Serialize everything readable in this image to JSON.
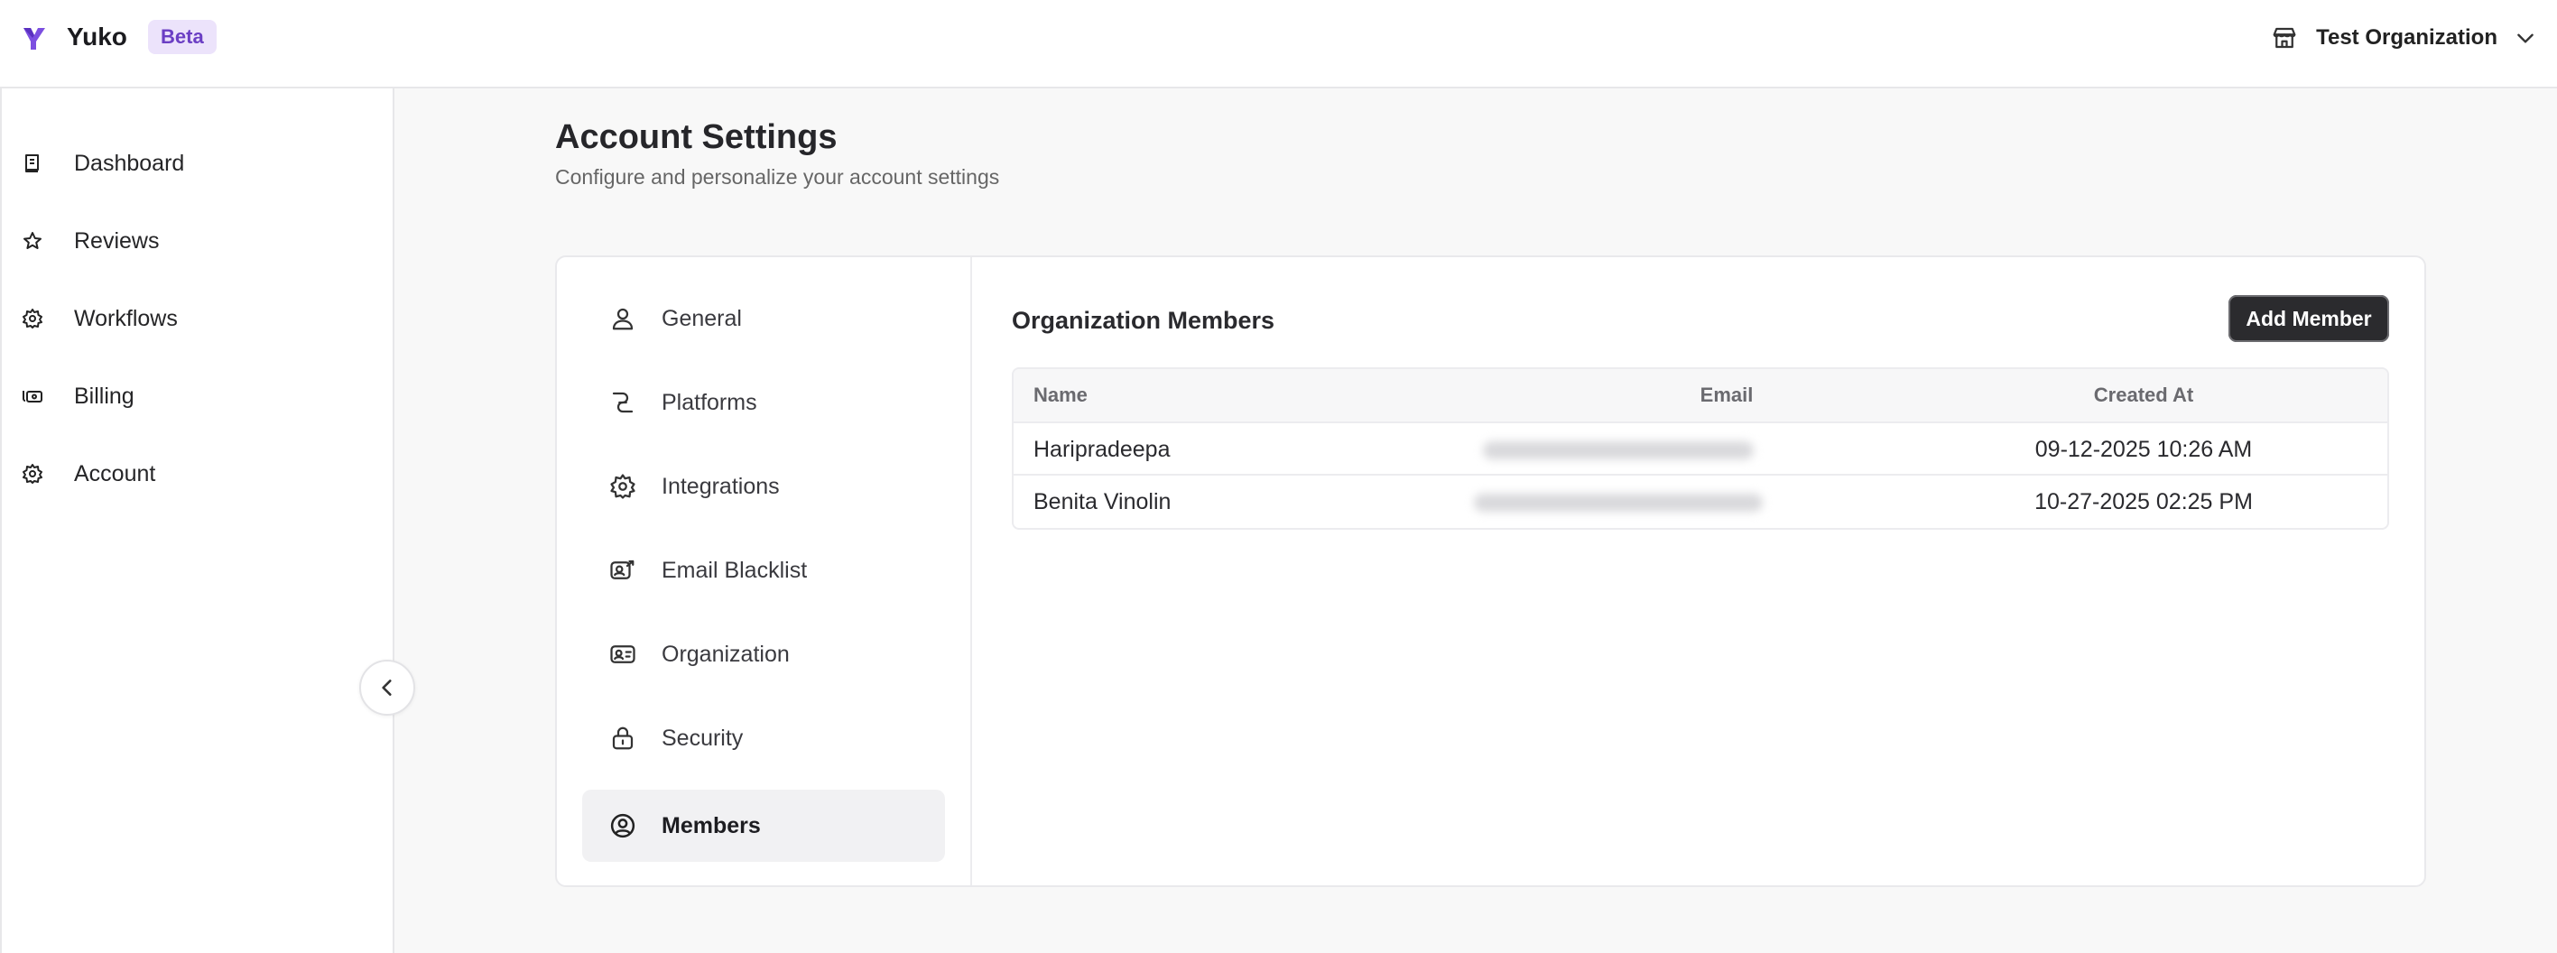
{
  "header": {
    "brand": "Yuko",
    "badge": "Beta",
    "organization": "Test Organization"
  },
  "sidebar": {
    "items": [
      {
        "label": "Dashboard",
        "icon": "book-icon"
      },
      {
        "label": "Reviews",
        "icon": "star-icon"
      },
      {
        "label": "Workflows",
        "icon": "cog-icon"
      },
      {
        "label": "Billing",
        "icon": "cash-icon"
      },
      {
        "label": "Account",
        "icon": "gear-icon"
      }
    ]
  },
  "page": {
    "title": "Account Settings",
    "subtitle": "Configure and personalize your account settings"
  },
  "settings_nav": {
    "items": [
      {
        "label": "General",
        "icon": "user-icon"
      },
      {
        "label": "Platforms",
        "icon": "link-icon"
      },
      {
        "label": "Integrations",
        "icon": "gear-icon"
      },
      {
        "label": "Email Blacklist",
        "icon": "mail-block-icon"
      },
      {
        "label": "Organization",
        "icon": "id-card-icon"
      },
      {
        "label": "Security",
        "icon": "lock-icon"
      },
      {
        "label": "Members",
        "icon": "user-circle-icon"
      }
    ],
    "active": "Members"
  },
  "members": {
    "title": "Organization Members",
    "add_button": "Add Member",
    "columns": [
      "Name",
      "Email",
      "Created At"
    ],
    "rows": [
      {
        "name": "Haripradeepa",
        "created_at": "09-12-2025 10:26 AM"
      },
      {
        "name": "Benita Vinolin",
        "created_at": "10-27-2025 02:25 PM"
      }
    ]
  },
  "colors": {
    "accent": "#6b3fc4",
    "badge_bg": "#ece3fb",
    "button_dark": "#2b2b2e"
  }
}
